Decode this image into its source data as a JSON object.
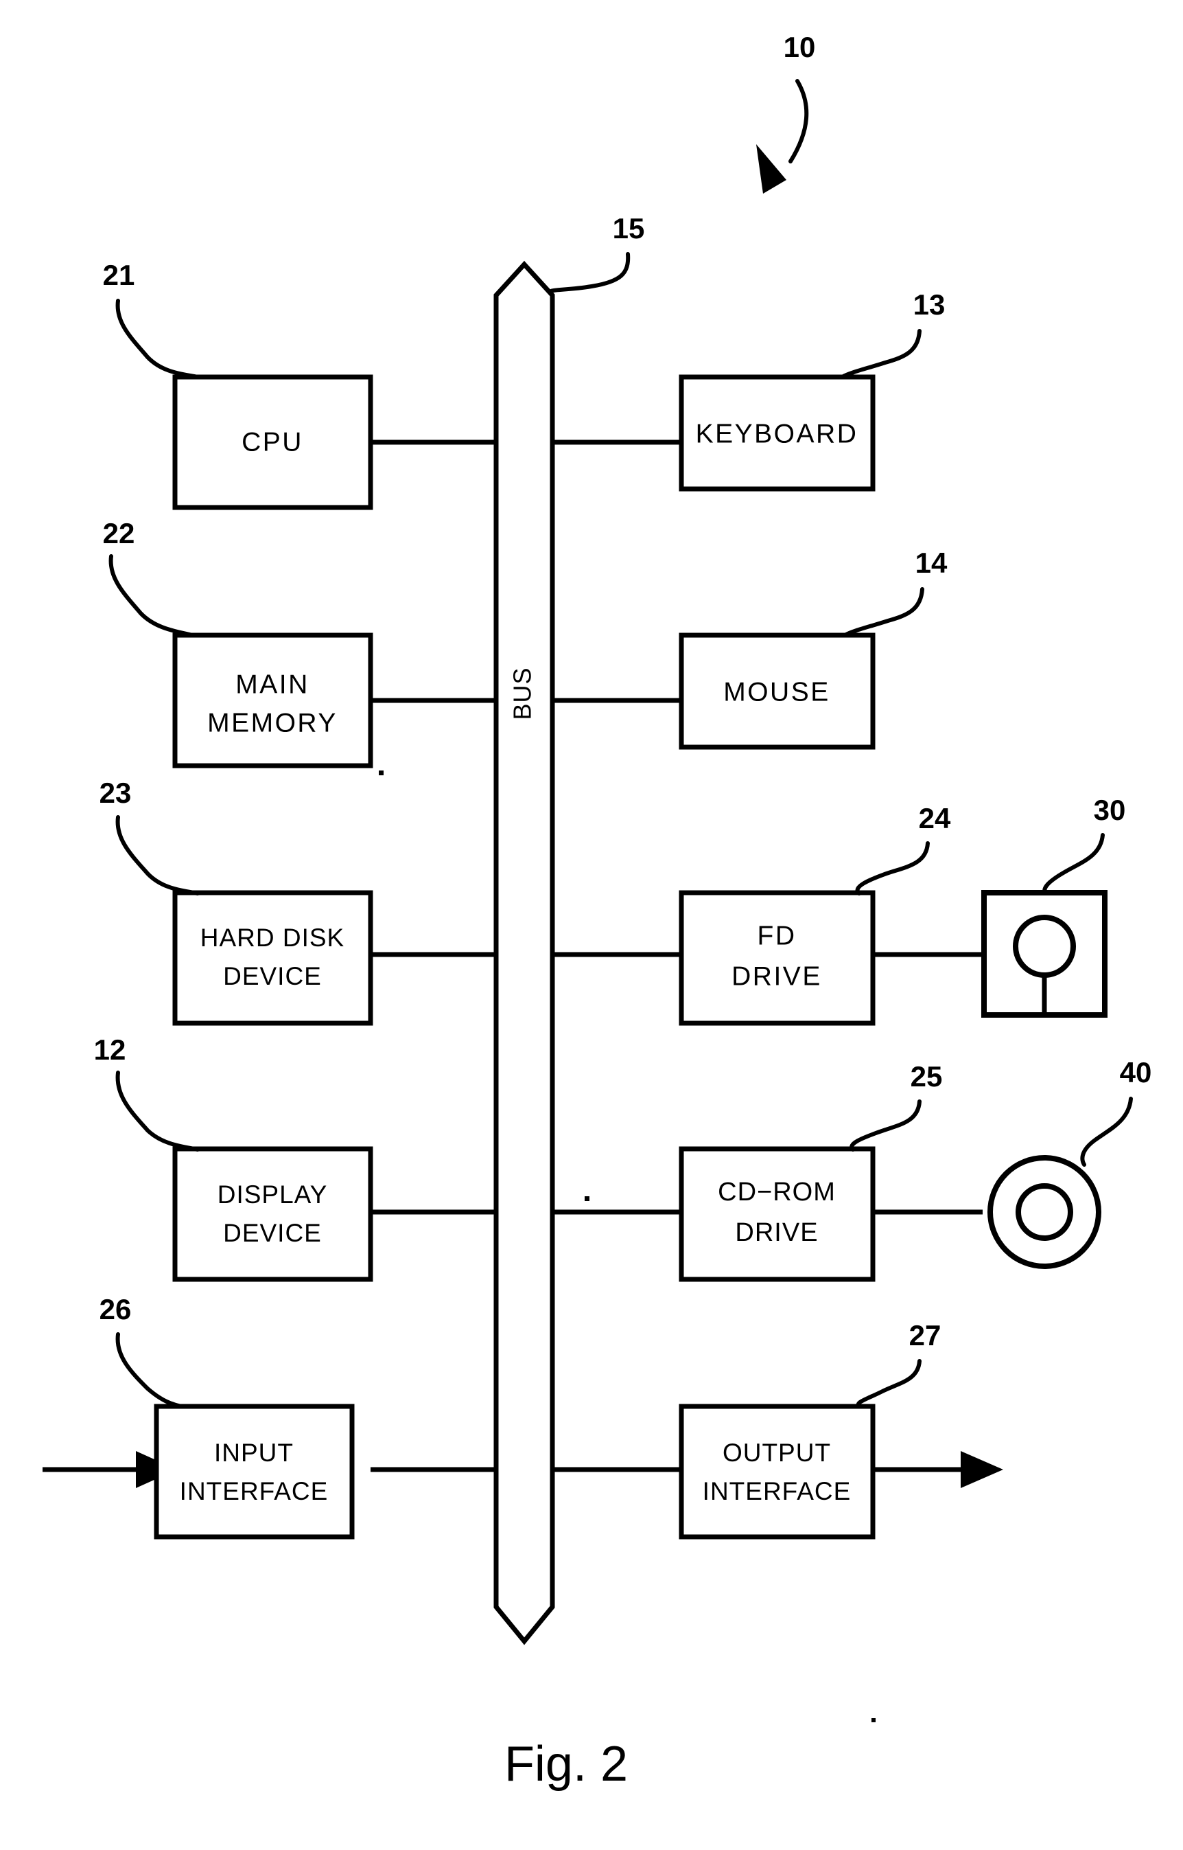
{
  "figure": {
    "caption": "Fig. 2",
    "system_ref": "10",
    "bus": {
      "label": "BUS",
      "ref": "15"
    }
  },
  "left_column": [
    {
      "label_line1": "CPU",
      "label_line2": "",
      "ref": "21"
    },
    {
      "label_line1": "MAIN",
      "label_line2": "MEMORY",
      "ref": "22"
    },
    {
      "label_line1": "HARD DISK",
      "label_line2": "DEVICE",
      "ref": "23"
    },
    {
      "label_line1": "DISPLAY",
      "label_line2": "DEVICE",
      "ref": "12"
    },
    {
      "label_line1": "INPUT",
      "label_line2": "INTERFACE",
      "ref": "26"
    }
  ],
  "right_column": [
    {
      "label_line1": "KEYBOARD",
      "label_line2": "",
      "ref": "13"
    },
    {
      "label_line1": "MOUSE",
      "label_line2": "",
      "ref": "14"
    },
    {
      "label_line1": "FD",
      "label_line2": "DRIVE",
      "ref": "24"
    },
    {
      "label_line1": "CD−ROM",
      "label_line2": "DRIVE",
      "ref": "25"
    },
    {
      "label_line1": "OUTPUT",
      "label_line2": "INTERFACE",
      "ref": "27"
    }
  ],
  "media": [
    {
      "name": "floppy-disk",
      "ref": "30"
    },
    {
      "name": "compact-disc",
      "ref": "40"
    }
  ],
  "colors": {
    "ink": "#000000",
    "paper": "#ffffff"
  }
}
